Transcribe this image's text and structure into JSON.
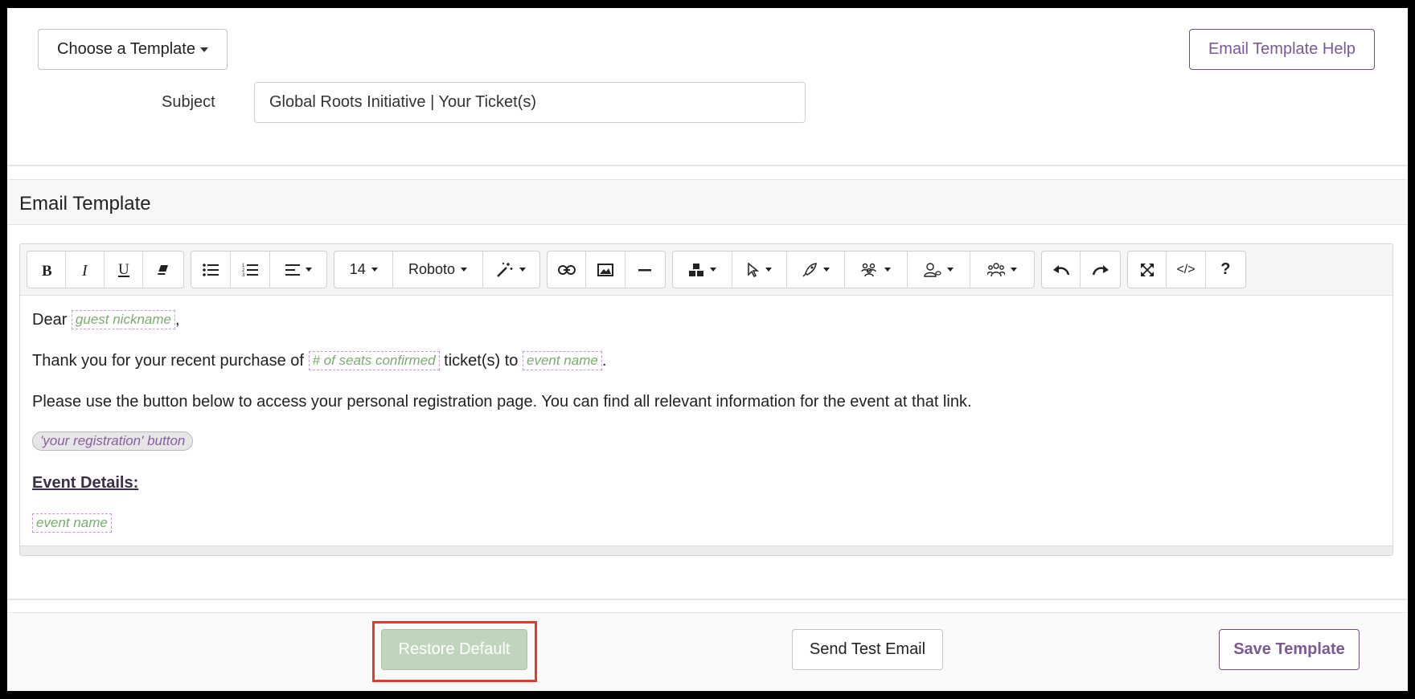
{
  "header": {
    "choose_template_label": "Choose a Template",
    "help_label": "Email Template Help",
    "subject_label": "Subject",
    "subject_value": "Global Roots Initiative | Your Ticket(s)"
  },
  "section": {
    "title": "Email Template"
  },
  "toolbar": {
    "font_size": "14",
    "font_family": "Roboto",
    "code_view_label": "</>",
    "help_label": "?"
  },
  "content": {
    "line1_prefix": "Dear",
    "line1_merge": "guest nickname",
    "line1_suffix": ",",
    "line2_prefix": "Thank you for your recent purchase of",
    "line2_merge1": "# of seats confirmed",
    "line2_mid": "ticket(s) to",
    "line2_merge2": "event name",
    "line2_suffix": ".",
    "line3": "Please use the button below to access your personal registration page. You can find all relevant information for the event at that link.",
    "button_pill": "'your registration' button",
    "event_details_heading": "Event Details:",
    "event_name_merge": "event name"
  },
  "footer": {
    "restore_label": "Restore Default",
    "test_label": "Send Test Email",
    "save_label": "Save Template"
  },
  "colors": {
    "accent_purple": "#7b5896",
    "merge_text_green": "#7aab72",
    "restore_button_green": "#bfd6bd",
    "highlight_red": "#e53b2c"
  }
}
